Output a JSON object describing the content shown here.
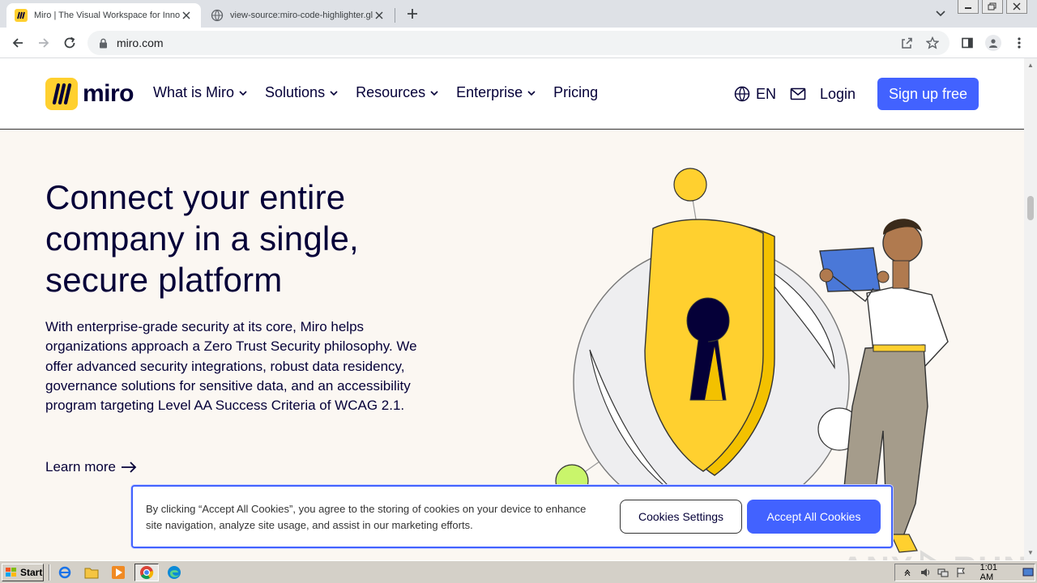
{
  "browser": {
    "tabs": [
      {
        "title": "Miro | The Visual Workspace for Innovation",
        "active": true
      },
      {
        "title": "view-source:miro-code-highlighter.glitch.me",
        "active": false
      }
    ],
    "url": "miro.com"
  },
  "site": {
    "logo_text": "miro",
    "nav": [
      {
        "label": "What is Miro",
        "has_dropdown": true
      },
      {
        "label": "Solutions",
        "has_dropdown": true
      },
      {
        "label": "Resources",
        "has_dropdown": true
      },
      {
        "label": "Enterprise",
        "has_dropdown": true
      },
      {
        "label": "Pricing",
        "has_dropdown": false
      }
    ],
    "language": "EN",
    "login_label": "Login",
    "signup_label": "Sign up free"
  },
  "hero": {
    "title_lines": [
      "Connect your entire",
      "company in a single,",
      "secure platform"
    ],
    "body": "With enterprise-grade security at its core, Miro helps organizations approach a Zero Trust Security philosophy. We offer advanced security integrations, robust data residency, governance solutions for sensitive data, and an accessibility program targeting Level AA Success Criteria of WCAG 2.1.",
    "learn_more": "Learn more"
  },
  "cookie_banner": {
    "text": "By clicking “Accept All Cookies”, you agree to the storing of cookies on your device to enhance site navigation, analyze site usage, and assist in our marketing efforts.",
    "settings_label": "Cookies Settings",
    "accept_label": "Accept All Cookies"
  },
  "watermark": {
    "left": "ANY",
    "right": "RUN"
  },
  "taskbar": {
    "start_label": "Start",
    "clock": "1:01 AM"
  },
  "colors": {
    "brand_yellow": "#ffd02f",
    "brand_blue": "#4262ff",
    "hero_bg": "#fbf7f2",
    "ink": "#050038"
  }
}
